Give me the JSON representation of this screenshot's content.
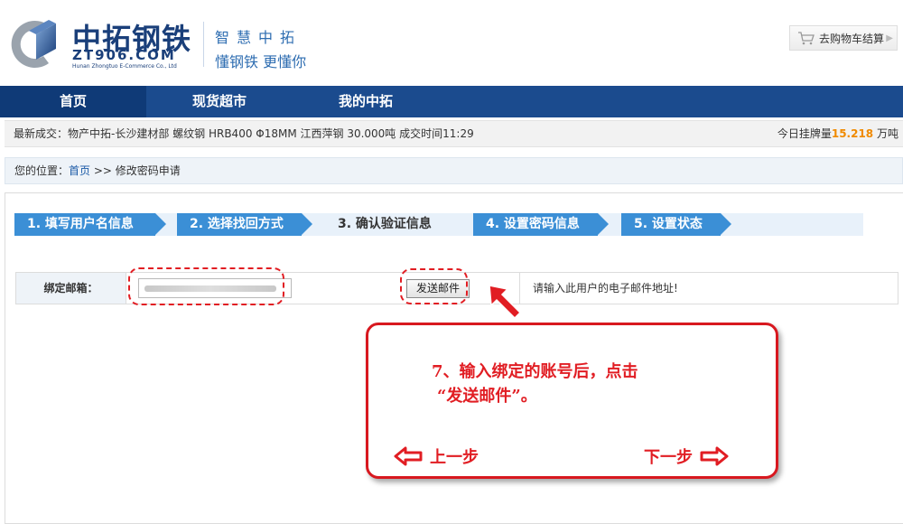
{
  "header": {
    "logo_cn": "中拓钢铁",
    "logo_en": "ZT906.COM",
    "logo_sub": "Hunan Zhongtuo E-Commerce Co., Ltd",
    "slogan_line1": "智慧中拓",
    "slogan_line2": "懂钢铁 更懂你",
    "cart_label": "去购物车结算"
  },
  "nav": {
    "items": [
      {
        "label": "首页"
      },
      {
        "label": "现货超市"
      },
      {
        "label": "我的中拓"
      }
    ]
  },
  "ticker": {
    "latest_deal": "最新成交：物产中拓-长沙建材部 螺纹钢 HRB400 Φ18MM 江西萍钢 30.000吨 成交时间11:29",
    "today_prefix": "今日挂牌量",
    "today_value": "15.218",
    "today_unit": "万吨"
  },
  "breadcrumb": {
    "prefix": "您的位置：",
    "home": "首页",
    "sep": " >> ",
    "current": "修改密码申请"
  },
  "steps": [
    {
      "label": "1. 填写用户名信息"
    },
    {
      "label": "2. 选择找回方式"
    },
    {
      "label": "3. 确认验证信息"
    },
    {
      "label": "4. 设置密码信息"
    },
    {
      "label": "5. 设置状态"
    }
  ],
  "form": {
    "email_label": "绑定邮箱：",
    "send_button": "发送邮件",
    "hint": "请输入此用户的电子邮件地址!"
  },
  "callout": {
    "line1": "7、输入绑定的账号后，点击",
    "line2": "“发送邮件”。",
    "prev": "上一步",
    "next": "下一步"
  },
  "colors": {
    "nav_bg": "#1b4b8e",
    "step_blue": "#3b8fd6",
    "annotation_red": "#e11d23",
    "highlight_orange": "#f08a00"
  }
}
